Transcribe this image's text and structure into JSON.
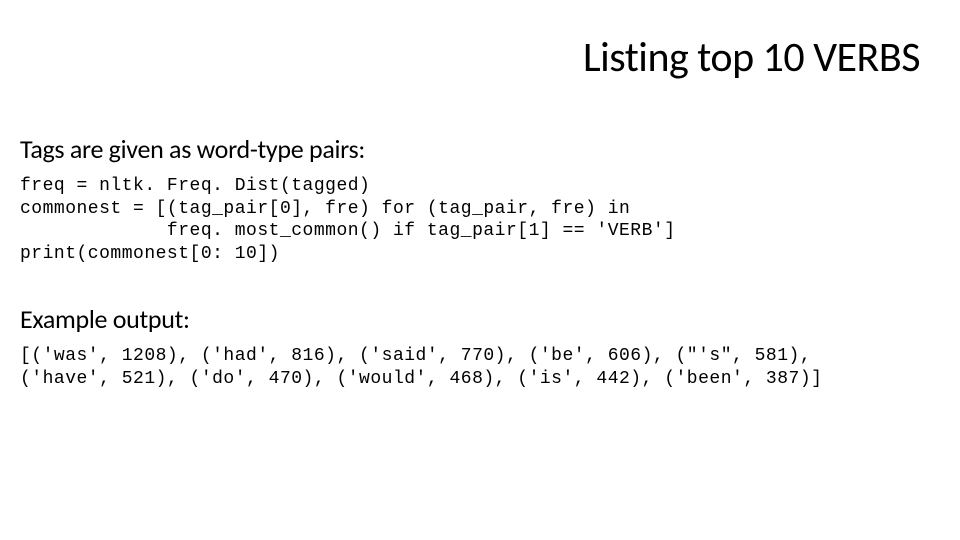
{
  "slide": {
    "title": "Listing top 10 VERBS",
    "section1_heading": "Tags are given as word-type pairs:",
    "code_line1": "freq = nltk. Freq. Dist(tagged)",
    "code_line2": "commonest = [(tag_pair[0], fre) for (tag_pair, fre) in",
    "code_line3": "             freq. most_common() if tag_pair[1] == 'VERB']",
    "code_line4": "print(commonest[0: 10])",
    "section2_heading": "Example output:",
    "output_line1": "[('was', 1208), ('had', 816), ('said', 770), ('be', 606), (\"'s\", 581),",
    "output_line2": "('have', 521), ('do', 470), ('would', 468), ('is', 442), ('been', 387)]"
  }
}
